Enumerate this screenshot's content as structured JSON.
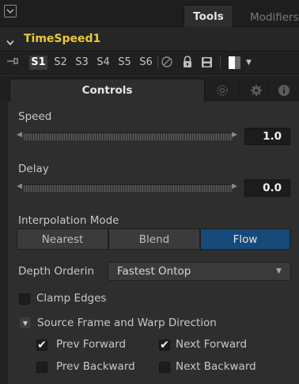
{
  "topbar": {
    "tabs": [
      {
        "label": "Tools",
        "active": true
      },
      {
        "label": "Modifiers",
        "active": false
      }
    ]
  },
  "node": {
    "title": "TimeSpeed1",
    "title_color": "#e9c93a"
  },
  "versions": {
    "items": [
      "S1",
      "S2",
      "S3",
      "S4",
      "S5",
      "S6"
    ],
    "active": "S1"
  },
  "panel_tabs": {
    "controls_label": "Controls",
    "icons": [
      "masks-icon",
      "gear-icon",
      "info-icon"
    ]
  },
  "speed": {
    "label": "Speed",
    "value": "1.0"
  },
  "delay": {
    "label": "Delay",
    "value": "0.0"
  },
  "interpolation": {
    "label": "Interpolation Mode",
    "options": [
      "Nearest",
      "Blend",
      "Flow"
    ],
    "selected": "Flow",
    "selected_color": "#154a7a"
  },
  "depth": {
    "label": "Depth Orderin",
    "value": "Fastest Ontop"
  },
  "clamp": {
    "label": "Clamp Edges",
    "checked": false
  },
  "source_frame": {
    "label": "Source Frame and Warp Direction",
    "prev_forward": {
      "label": "Prev Forward",
      "checked": true
    },
    "next_forward": {
      "label": "Next Forward",
      "checked": true
    },
    "prev_backward": {
      "label": "Prev Backward",
      "checked": false
    },
    "next_backward": {
      "label": "Next Backward",
      "checked": false
    }
  }
}
